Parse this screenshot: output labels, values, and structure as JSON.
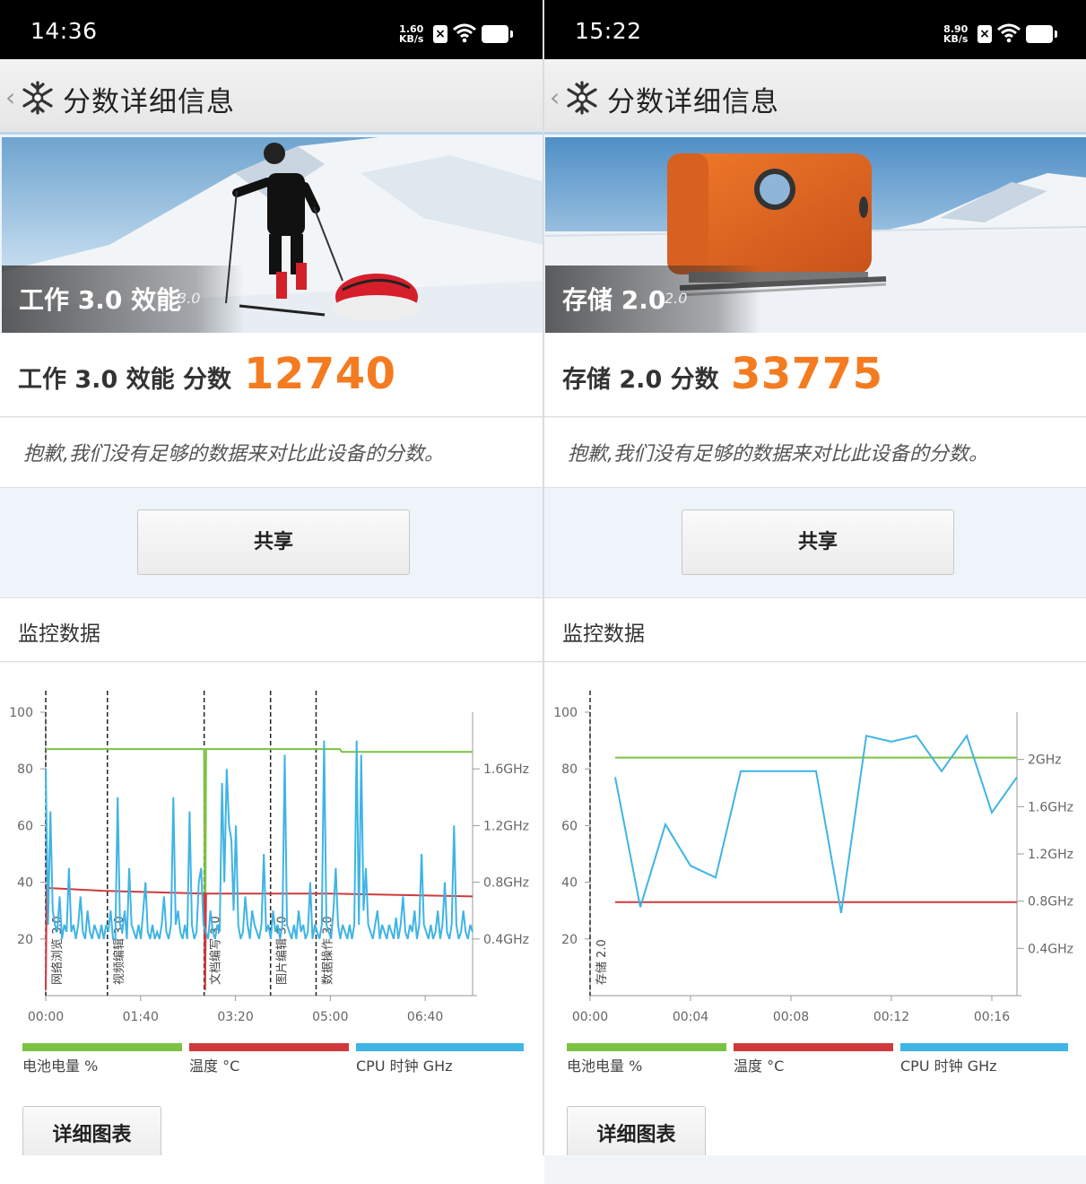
{
  "panels": [
    {
      "statusbar": {
        "time": "14:36",
        "speed_value": "1.60",
        "speed_unit": "KB/s"
      },
      "header": {
        "title": "分数详细信息"
      },
      "hero": {
        "name": "工作 3.0 效能",
        "version": "3.0"
      },
      "score": {
        "label": "工作 3.0 效能 分数",
        "value": "12740"
      },
      "notice": "抱歉,我们没有足够的数据来对比此设备的分数。",
      "share_label": "共享",
      "monitor": {
        "title": "监控数据"
      },
      "legend": [
        {
          "label": "电池电量 %",
          "color": "#7cc242"
        },
        {
          "label": "温度 °C",
          "color": "#d0393c"
        },
        {
          "label": "CPU 时钟 GHz",
          "color": "#3fb4e5"
        }
      ],
      "detail_label": "详细图表"
    },
    {
      "statusbar": {
        "time": "15:22",
        "speed_value": "8.90",
        "speed_unit": "KB/s"
      },
      "header": {
        "title": "分数详细信息"
      },
      "hero": {
        "name": "存储 2.0",
        "version": "2.0"
      },
      "score": {
        "label": "存储 2.0 分数",
        "value": "33775"
      },
      "notice": "抱歉,我们没有足够的数据来对比此设备的分数。",
      "share_label": "共享",
      "monitor": {
        "title": "监控数据"
      },
      "legend": [
        {
          "label": "电池电量 %",
          "color": "#7cc242"
        },
        {
          "label": "温度 °C",
          "color": "#d0393c"
        },
        {
          "label": "CPU 时钟 GHz",
          "color": "#3fb4e5"
        }
      ],
      "detail_label": "详细图表"
    }
  ],
  "chart_data": [
    {
      "type": "line",
      "x_ticks": [
        "00:00",
        "01:40",
        "03:20",
        "05:00",
        "06:40"
      ],
      "y_left_ticks": [
        "100",
        "80",
        "60",
        "40",
        "20"
      ],
      "y_left_range": [
        0,
        100
      ],
      "y_right_ticks": [
        "1.6GHz",
        "1.2GHz",
        "0.8GHz",
        "0.4GHz"
      ],
      "y_right_range_ghz": [
        0,
        2.0
      ],
      "x_range_seconds": [
        0,
        450
      ],
      "markers": [
        {
          "t": 0,
          "label": "网络浏览 3.0"
        },
        {
          "t": 65,
          "label": "视频编辑 3.0"
        },
        {
          "t": 167,
          "label": "文档编写 3.0"
        },
        {
          "t": 237,
          "label": "图片编辑 3.0"
        },
        {
          "t": 285,
          "label": "数据操作 3.0"
        }
      ],
      "series": [
        {
          "name": "电池电量 %",
          "color": "#7cc242",
          "points": [
            [
              0,
              87
            ],
            [
              167,
              87
            ],
            [
              168,
              2
            ],
            [
              169,
              87
            ],
            [
              310,
              87
            ],
            [
              312,
              86
            ],
            [
              450,
              86
            ]
          ]
        },
        {
          "name": "温度 °C",
          "color": "#d0393c",
          "points": [
            [
              0,
              2
            ],
            [
              1,
              38
            ],
            [
              60,
              37
            ],
            [
              167,
              36
            ],
            [
              168,
              2
            ],
            [
              169,
              36
            ],
            [
              300,
              36
            ],
            [
              450,
              35
            ]
          ]
        },
        {
          "name": "CPU 时钟 GHz",
          "color": "#3fb4e5",
          "samples_ghz": [
            1.6,
            0.5,
            1.3,
            0.6,
            0.5,
            0.45,
            0.7,
            0.4,
            0.5,
            0.45,
            0.9,
            0.45,
            0.5,
            0.4,
            0.5,
            0.7,
            0.45,
            0.4,
            0.6,
            0.45,
            0.4,
            0.5,
            0.45,
            0.4,
            0.5,
            0.4,
            0.5,
            0.45,
            0.6,
            0.4,
            0.4,
            1.4,
            0.5,
            0.45,
            0.6,
            0.4,
            0.9,
            0.5,
            0.45,
            0.4,
            0.5,
            0.4,
            0.6,
            0.8,
            0.45,
            0.4,
            0.5,
            0.4,
            0.45,
            0.4,
            0.5,
            0.7,
            0.45,
            0.4,
            0.5,
            1.4,
            0.5,
            0.6,
            0.45,
            0.4,
            0.5,
            0.4,
            1.3,
            0.5,
            0.4,
            0.45,
            0.8,
            0.9,
            0.5,
            0.45,
            0.4,
            0.6,
            0.45,
            0.4,
            0.5,
            0.45,
            1.5,
            0.8,
            1.6,
            1.2,
            1.1,
            0.6,
            1.2,
            0.5,
            0.4,
            0.45,
            0.7,
            0.5,
            0.4,
            0.6,
            0.5,
            0.45,
            0.4,
            0.5,
            1.0,
            0.45,
            0.5,
            0.4,
            0.6,
            0.45,
            0.5,
            0.4,
            0.5,
            1.7,
            0.5,
            0.45,
            0.4,
            0.5,
            0.4,
            0.6,
            0.45,
            0.5,
            0.4,
            0.45,
            0.8,
            0.4,
            0.5,
            0.45,
            0.4,
            0.5,
            1.8,
            0.5,
            0.45,
            0.4,
            0.6,
            0.9,
            0.5,
            0.4,
            0.5,
            0.45,
            0.4,
            0.5,
            0.4,
            0.5,
            1.8,
            0.5,
            1.7,
            0.6,
            0.9,
            0.5,
            0.45,
            0.4,
            0.5,
            0.6,
            0.4,
            0.5,
            0.45,
            0.4,
            0.5,
            0.45,
            0.4,
            0.55,
            0.4,
            0.5,
            0.7,
            0.45,
            0.4,
            0.5,
            0.45,
            0.6,
            0.4,
            0.5,
            1.0,
            0.5,
            0.45,
            0.4,
            0.5,
            0.4,
            0.45,
            0.6,
            0.4,
            0.5,
            0.8,
            0.45,
            0.4,
            0.5,
            1.2,
            0.5,
            0.4,
            0.45,
            0.6,
            0.45,
            0.4,
            0.5,
            0.45
          ]
        }
      ]
    },
    {
      "type": "line",
      "x_ticks": [
        "00:00",
        "00:04",
        "00:08",
        "00:12",
        "00:16"
      ],
      "y_left_ticks": [
        "100",
        "80",
        "60",
        "40",
        "20"
      ],
      "y_left_range": [
        0,
        100
      ],
      "y_right_ticks": [
        "2GHz",
        "1.6GHz",
        "1.2GHz",
        "0.8GHz",
        "0.4GHz"
      ],
      "y_right_range_ghz": [
        0,
        2.4
      ],
      "x_range_seconds": [
        0,
        17
      ],
      "markers": [
        {
          "t": 0,
          "label": "存储 2.0"
        }
      ],
      "series": [
        {
          "name": "电池电量 %",
          "color": "#7cc242",
          "points": [
            [
              1,
              84
            ],
            [
              17,
              84
            ]
          ]
        },
        {
          "name": "温度 °C",
          "color": "#d0393c",
          "points": [
            [
              1,
              33
            ],
            [
              17,
              33
            ]
          ]
        },
        {
          "name": "CPU 时钟 GHz",
          "color": "#3fb4e5",
          "points": [
            [
              1,
              1.85
            ],
            [
              2,
              0.75
            ],
            [
              3,
              1.45
            ],
            [
              4,
              1.1
            ],
            [
              5,
              1.0
            ],
            [
              6,
              1.9
            ],
            [
              9,
              1.9
            ],
            [
              10,
              0.7
            ],
            [
              11,
              2.2
            ],
            [
              12,
              2.15
            ],
            [
              13,
              2.2
            ],
            [
              14,
              1.9
            ],
            [
              15,
              2.2
            ],
            [
              16,
              1.55
            ],
            [
              17,
              1.85
            ]
          ]
        }
      ]
    }
  ]
}
